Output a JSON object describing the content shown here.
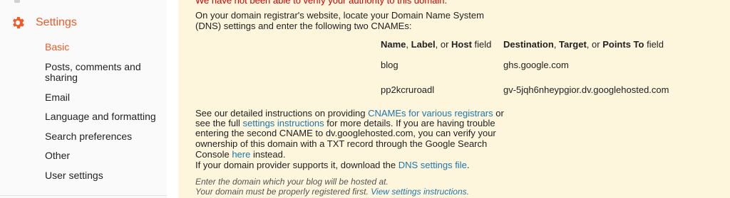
{
  "sidebar": {
    "settings_label": "Settings",
    "settings_icon": "gear-icon",
    "accent_color": "#ef5b25",
    "items": [
      {
        "label": "Basic",
        "active": true
      },
      {
        "label": "Posts, comments and"
      },
      {
        "label": "sharing"
      },
      {
        "label": "Email"
      },
      {
        "label": "Language and formatting"
      },
      {
        "label": "Search preferences"
      },
      {
        "label": "Other"
      },
      {
        "label": "User settings"
      }
    ]
  },
  "main": {
    "error": "We have not been able to verify your authority to this domain.",
    "intro_line1": "On your domain registrar's website, locate your Domain Name System",
    "intro_line2": "(DNS) settings and enter the following two CNAMEs:",
    "table": {
      "col1": {
        "name": "Name",
        "sep1": ", ",
        "label": "Label",
        "sep2": ", or ",
        "host": "Host",
        "rest": " field"
      },
      "col2": {
        "dest": "Destination",
        "sep1": ", ",
        "target": "Target",
        "sep2": ", or ",
        "points": "Points To",
        "rest": " field"
      },
      "rows": [
        {
          "name": "blog",
          "destination": "ghs.google.com"
        },
        {
          "name": "pp2kcruroadl",
          "destination": "gv-5jqh6nheypgior.dv.googlehosted.com"
        }
      ]
    },
    "help": {
      "l1_a": "See our detailed instructions on providing ",
      "l1_link": "CNAMEs for various registrars",
      "l1_b": " or",
      "l2_a": "see the full ",
      "l2_link": "settings instructions",
      "l2_b": " for more details. If you are having trouble",
      "l3": "entering the second CNAME to dv.googlehosted.com, you can verify your",
      "l4": "ownership of this domain with a TXT record through the Google Search",
      "l5_a": "Console ",
      "l5_link": "here",
      "l5_b": " instead.",
      "l6_a": "If your domain provider supports it, download the ",
      "l6_link": "DNS settings file",
      "l6_b": "."
    },
    "note1": "Enter the domain which your blog will be hosted at.",
    "note2_a": "Your domain must be properly registered first. ",
    "note2_link": "View settings instructions",
    "note2_b": ".",
    "panel_color": "#fdf5dc",
    "error_color": "#cc0000",
    "link_color": "#2077aa"
  }
}
